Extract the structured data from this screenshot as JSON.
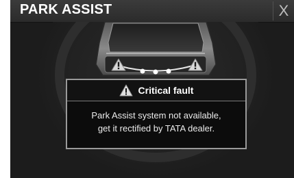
{
  "header": {
    "title": "PARK ASSIST",
    "close_label": "X"
  },
  "dialog": {
    "icon": "warning-triangle-icon",
    "title": "Critical fault",
    "message_line1": "Park Assist system not available,",
    "message_line2": "get it rectified by TATA dealer."
  },
  "sensors": {
    "icon": "warning-triangle-icon",
    "left_status": "fault",
    "right_status": "fault",
    "rear_center_indicator_dots": 3
  },
  "colors": {
    "background": "#1c1c1c",
    "header": "#333333",
    "dialog_border": "#9a9a9a",
    "text": "#ffffff"
  }
}
